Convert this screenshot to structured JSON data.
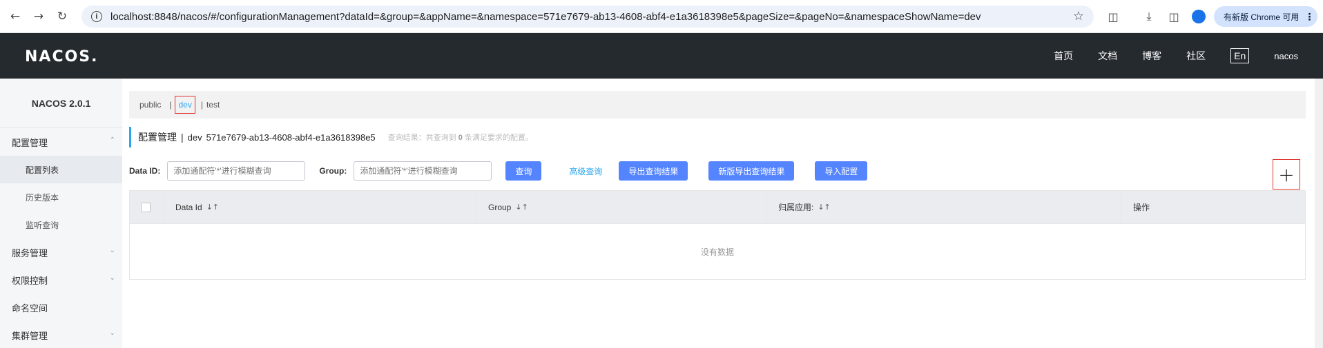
{
  "browser": {
    "url": "localhost:8848/nacos/#/configurationManagement?dataId=&group=&appName=&namespace=571e7679-ab13-4608-abf4-e1a3618398e5&pageSize=&pageNo=&namespaceShowName=dev",
    "update_label": "有新版 Chrome 可用",
    "icons": [
      "back-icon",
      "forward-icon",
      "reload-icon",
      "info-icon",
      "star-icon",
      "extensions-icon",
      "download-icon",
      "sidepanel-icon",
      "profile-icon"
    ]
  },
  "header": {
    "logo": "NACOS.",
    "nav": [
      "首页",
      "文档",
      "博客",
      "社区"
    ],
    "lang": "En",
    "user": "nacos"
  },
  "sidebar": {
    "title": "NACOS 2.0.1",
    "groups": [
      {
        "label": "配置管理",
        "expanded": true,
        "items": [
          "配置列表",
          "历史版本",
          "监听查询"
        ]
      },
      {
        "label": "服务管理",
        "expanded": false
      },
      {
        "label": "权限控制",
        "expanded": false
      },
      {
        "label": "命名空间"
      },
      {
        "label": "集群管理",
        "expanded": false
      }
    ]
  },
  "namespaces": {
    "items": [
      "public",
      "dev",
      "test"
    ],
    "active": "dev"
  },
  "title": {
    "main": "配置管理",
    "sep": "|",
    "ns": "dev",
    "ns_id": "571e7679-ab13-4608-abf4-e1a3618398e5",
    "result_prefix": "查询结果：共查询到",
    "result_count": "0",
    "result_suffix": "条满足要求的配置。"
  },
  "search": {
    "dataid_label": "Data ID:",
    "dataid_placeholder": "添加通配符'*'进行模糊查询",
    "group_label": "Group:",
    "group_placeholder": "添加通配符'*'进行模糊查询",
    "query": "查询",
    "advanced": "高级查询",
    "export": "导出查询结果",
    "export_new": "新版导出查询结果",
    "import": "导入配置",
    "add": "+"
  },
  "table": {
    "columns": [
      "Data Id",
      "Group",
      "归属应用:",
      "操作"
    ],
    "empty": "没有数据"
  },
  "colors": {
    "header_bg": "#252a2f",
    "primary": "#5584ff",
    "link": "#2aa5ee",
    "highlight_border": "#e0302b"
  }
}
